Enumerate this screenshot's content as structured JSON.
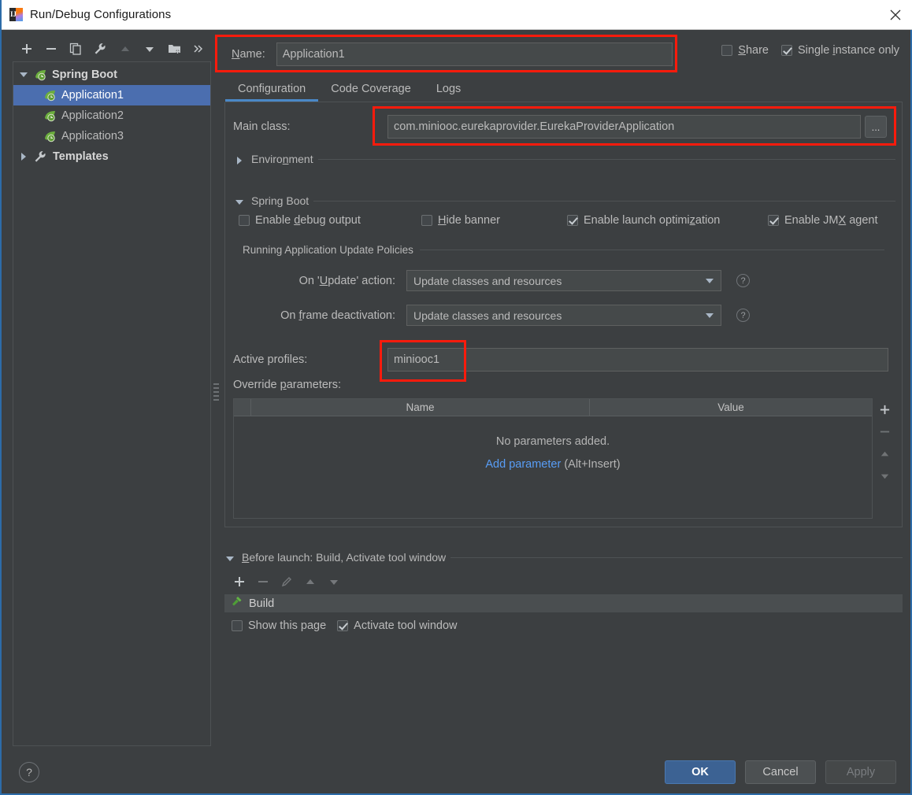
{
  "window": {
    "title": "Run/Debug Configurations",
    "app_icon": "intellij-idea-icon",
    "close_icon": "close-icon"
  },
  "toolbar": {
    "buttons": [
      {
        "name": "add",
        "icon": "plus-icon",
        "enabled": true
      },
      {
        "name": "remove",
        "icon": "minus-icon",
        "enabled": true
      },
      {
        "name": "copy",
        "icon": "copy-icon",
        "enabled": true
      },
      {
        "name": "edit-templates",
        "icon": "wrench-icon",
        "enabled": true
      },
      {
        "name": "move-up",
        "icon": "arrow-up-icon",
        "enabled": false
      },
      {
        "name": "move-down",
        "icon": "arrow-down-icon",
        "enabled": true
      },
      {
        "name": "create-folder",
        "icon": "folder-add-icon",
        "enabled": true
      },
      {
        "name": "more",
        "icon": "chevron-double-right-icon",
        "enabled": true
      }
    ]
  },
  "tree": {
    "nodes": [
      {
        "label": "Spring Boot",
        "icon": "spring-boot-leaf-icon",
        "expanded": true,
        "selected": false
      },
      {
        "label": "Application1",
        "icon": "spring-boot-leaf-icon",
        "selected": true
      },
      {
        "label": "Application2",
        "icon": "spring-boot-leaf-icon",
        "selected": false
      },
      {
        "label": "Application3",
        "icon": "spring-boot-leaf-icon",
        "selected": false
      },
      {
        "label": "Templates",
        "icon": "wrench-icon",
        "expanded": false,
        "selected": false
      }
    ]
  },
  "name_row": {
    "label": "Name:",
    "label_mnemonic": "N",
    "value": "Application1",
    "placeholder": ""
  },
  "top_checks": {
    "share": {
      "label": "Share",
      "mnemonic": "S",
      "checked": false
    },
    "single_instance": {
      "label": "Single instance only",
      "mnemonic": "i",
      "checked": true
    }
  },
  "tabs": [
    {
      "label": "Configuration",
      "active": true
    },
    {
      "label": "Code Coverage",
      "active": false
    },
    {
      "label": "Logs",
      "active": false
    }
  ],
  "main_class": {
    "label": "Main class:",
    "value": "com.miniooc.eurekaprovider.EurekaProviderApplication",
    "browse_label": "...",
    "browse_icon": "ellipsis-icon"
  },
  "environment_section": {
    "label": "Environment",
    "mnemonic": "n",
    "expanded": false,
    "icon": "triangle-right-icon"
  },
  "spring_boot_section": {
    "label": "Spring Boot",
    "expanded": true,
    "icon": "triangle-down-icon",
    "checkboxes": [
      {
        "label": "Enable debug output",
        "mnemonic": "d",
        "checked": false
      },
      {
        "label": "Hide banner",
        "mnemonic": "H",
        "checked": false
      },
      {
        "label": "Enable launch optimization",
        "mnemonic": "z",
        "checked": true
      },
      {
        "label": "Enable JMX agent",
        "mnemonic": "X",
        "checked": true
      }
    ],
    "update_policies_label": "Running Application Update Policies",
    "update_action": {
      "label": "On 'Update' action:",
      "mnemonic": "U",
      "value": "Update classes and resources",
      "help_icon": "question-circle-icon"
    },
    "frame_deactivation": {
      "label": "On frame deactivation:",
      "mnemonic": "f",
      "value": "Update classes and resources",
      "help_icon": "question-circle-icon"
    },
    "active_profiles": {
      "label": "Active profiles:",
      "value": "miniooc1",
      "placeholder": ""
    },
    "override_parameters": {
      "label": "Override parameters:",
      "mnemonic": "p",
      "columns": [
        "",
        "Name",
        "Value"
      ],
      "rows": [],
      "empty_text": "No parameters added.",
      "add_link": "Add parameter",
      "add_shortcut": "(Alt+Insert)",
      "side_buttons": [
        {
          "name": "add-parameter",
          "icon": "plus-icon",
          "enabled": true
        },
        {
          "name": "remove-parameter",
          "icon": "minus-icon",
          "enabled": false
        },
        {
          "name": "move-parameter-up",
          "icon": "arrow-up-icon",
          "enabled": false
        },
        {
          "name": "move-parameter-down",
          "icon": "arrow-down-icon",
          "enabled": false
        }
      ]
    }
  },
  "before_launch": {
    "header": "Before launch: Build, Activate tool window",
    "mnemonic": "B",
    "expanded": true,
    "toolbar": [
      {
        "name": "add-task",
        "icon": "plus-icon",
        "enabled": true
      },
      {
        "name": "remove-task",
        "icon": "minus-icon",
        "enabled": false
      },
      {
        "name": "edit-task",
        "icon": "pencil-icon",
        "enabled": false
      },
      {
        "name": "task-up",
        "icon": "arrow-up-icon",
        "enabled": false
      },
      {
        "name": "task-down",
        "icon": "arrow-down-icon",
        "enabled": false
      }
    ],
    "tasks": [
      {
        "label": "Build",
        "icon": "hammer-icon"
      }
    ],
    "checkboxes": [
      {
        "label": "Show this page",
        "checked": false
      },
      {
        "label": "Activate tool window",
        "checked": true
      }
    ]
  },
  "footer": {
    "help_icon": "question-circle-icon",
    "buttons": [
      {
        "label": "OK",
        "style": "primary",
        "enabled": true
      },
      {
        "label": "Cancel",
        "style": "default",
        "enabled": true
      },
      {
        "label": "Apply",
        "style": "default",
        "enabled": false
      }
    ]
  },
  "annotations": {
    "color": "#fa1b0c",
    "boxes": [
      {
        "name": "name-field-highlight"
      },
      {
        "name": "main-class-highlight"
      },
      {
        "name": "active-profiles-highlight"
      }
    ]
  }
}
